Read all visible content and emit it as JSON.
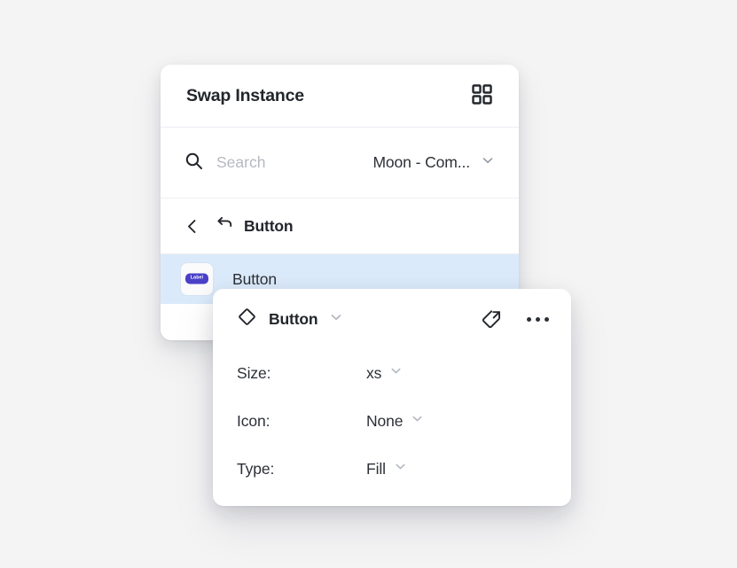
{
  "swap_panel": {
    "title": "Swap Instance",
    "grid_icon": "grid-2x2-icon",
    "search": {
      "icon": "search-icon",
      "value": "",
      "placeholder": "Search"
    },
    "library": {
      "label": "Moon - Com...",
      "chevron_icon": "chevron-down-icon"
    },
    "breadcrumb": {
      "back_icon": "chevron-left-icon",
      "swap_icon": "return-arrow-icon",
      "label": "Button"
    },
    "results": [
      {
        "thumb_icon": "component-thumbnail",
        "thumb_pill_label": "Label",
        "label": "Button",
        "selected": true
      }
    ]
  },
  "properties_popover": {
    "component": {
      "icon": "diamond-component-icon",
      "name": "Button",
      "chevron_icon": "chevron-down-icon"
    },
    "actions": {
      "go_to_main_component_icon": "go-to-main-component-icon",
      "more_options_icon": "ellipsis-icon"
    },
    "rows": [
      {
        "key": "Size:",
        "value": "xs",
        "chevron_icon": "chevron-down-icon"
      },
      {
        "key": "Icon:",
        "value": "None",
        "chevron_icon": "chevron-down-icon"
      },
      {
        "key": "Type:",
        "value": "Fill",
        "chevron_icon": "chevron-down-icon"
      }
    ]
  },
  "colors": {
    "page_background": "#F4F4F5",
    "panel_background": "#FFFFFF",
    "selected_row": "#DBEAFA",
    "accent_purple": "#4A40C8",
    "text_primary": "#23262B",
    "text_secondary": "#2C3036",
    "placeholder": "#B5B9C0",
    "divider": "#ECEEF1"
  }
}
